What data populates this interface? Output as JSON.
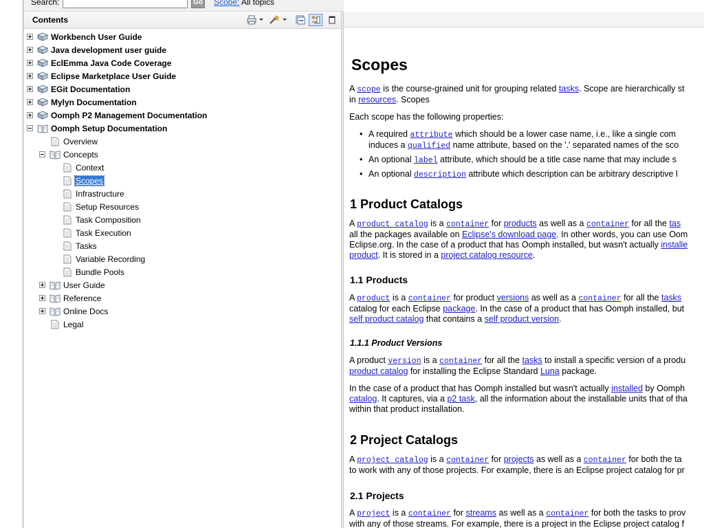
{
  "search": {
    "label": "Search:",
    "go_label": "Go",
    "scope_link": "Scope:",
    "scope_value": "All topics"
  },
  "contents": {
    "title": "Contents"
  },
  "tree": [
    {
      "label": "Workbench User Guide",
      "bold": true,
      "level": 0,
      "expander": "plus",
      "icon": "book-icon"
    },
    {
      "label": "Java development user guide",
      "bold": true,
      "level": 0,
      "expander": "plus",
      "icon": "book-icon"
    },
    {
      "label": "EclEmma Java Code Coverage",
      "bold": true,
      "level": 0,
      "expander": "plus",
      "icon": "book-icon"
    },
    {
      "label": "Eclipse Marketplace User Guide",
      "bold": true,
      "level": 0,
      "expander": "plus",
      "icon": "book-icon"
    },
    {
      "label": "EGit Documentation",
      "bold": true,
      "level": 0,
      "expander": "plus",
      "icon": "book-icon"
    },
    {
      "label": "Mylyn Documentation",
      "bold": true,
      "level": 0,
      "expander": "plus",
      "icon": "book-icon"
    },
    {
      "label": "Oomph P2 Management Documentation",
      "bold": true,
      "level": 0,
      "expander": "plus",
      "icon": "book-icon"
    },
    {
      "label": "Oomph Setup Documentation",
      "bold": true,
      "level": 0,
      "expander": "minus",
      "icon": "open-book-icon"
    },
    {
      "label": "Overview",
      "level": 1,
      "expander": "none",
      "icon": "page-icon"
    },
    {
      "label": "Concepts",
      "level": 1,
      "expander": "minus",
      "icon": "open-book-icon"
    },
    {
      "label": "Context",
      "level": 2,
      "expander": "none",
      "icon": "page-icon"
    },
    {
      "label": "Scopes",
      "level": 2,
      "expander": "none",
      "icon": "page-icon",
      "selected": true
    },
    {
      "label": "Infrastructure",
      "level": 2,
      "expander": "none",
      "icon": "page-icon"
    },
    {
      "label": "Setup Resources",
      "level": 2,
      "expander": "none",
      "icon": "page-icon"
    },
    {
      "label": "Task Composition",
      "level": 2,
      "expander": "none",
      "icon": "page-icon"
    },
    {
      "label": "Task Execution",
      "level": 2,
      "expander": "none",
      "icon": "page-icon"
    },
    {
      "label": "Tasks",
      "level": 2,
      "expander": "none",
      "icon": "page-icon"
    },
    {
      "label": "Variable Recording",
      "level": 2,
      "expander": "none",
      "icon": "page-icon"
    },
    {
      "label": "Bundle Pools",
      "level": 2,
      "expander": "none",
      "icon": "page-icon"
    },
    {
      "label": "User Guide",
      "level": 1,
      "expander": "plus",
      "icon": "open-book-icon"
    },
    {
      "label": "Reference",
      "level": 1,
      "expander": "plus",
      "icon": "open-book-icon"
    },
    {
      "label": "Online Docs",
      "level": 1,
      "expander": "plus",
      "icon": "open-book-icon"
    },
    {
      "label": "Legal",
      "level": 1,
      "expander": "none",
      "icon": "page-icon"
    }
  ],
  "doc": {
    "title": "Scopes",
    "intro": {
      "t1": "A ",
      "c1": "scope",
      "t2": " is the course-grained unit for grouping related ",
      "a1": "tasks",
      "t3": ". Scope are hierarchically st",
      "t4": "in ",
      "a2": "resources",
      "t5": ". Scopes"
    },
    "props_intro": "Each scope has the following properties:",
    "bullets": {
      "b1": {
        "t1": "A required ",
        "c1": "attribute",
        "t2": " which should be a lower case name, i.e., like a single com",
        "t3": "induces a ",
        "c2": "qualified",
        "t4": " name attribute, based on the '.' separated names of the sco"
      },
      "b2": {
        "t1": "An optional ",
        "c1": "label",
        "t2": " attribute, which should be a title case name that may include s"
      },
      "b3": {
        "t1": "An optional ",
        "c1": "description",
        "t2": " attribute which description can be arbitrary descriptive l"
      }
    },
    "s1": {
      "heading": "1  Product Catalogs",
      "t1": "A ",
      "c1": "product catalog",
      "t2": " is a ",
      "c2": "container",
      "t3": " for ",
      "a1": "products",
      "t4": " as well as a ",
      "c3": "container",
      "t5": " for all the ",
      "a2": "tas",
      "t6": "all the packages available on ",
      "a3": "Eclipse's download page",
      "t7": ". In other words, you can use Oom",
      "t8": "Eclipse.org. In the case of a product that has Oomph installed, but wasn't actually ",
      "a4": "installe",
      "a5": "product",
      "t9": ". It is stored in a ",
      "a6": "project catalog resource",
      "t10": "."
    },
    "s11": {
      "heading": "1.1  Products",
      "t1": "A ",
      "c1": "product",
      "t2": " is a ",
      "c2": "container",
      "t3": " for product ",
      "a1": "versions",
      "t4": " as well as a ",
      "c3": "container",
      "t5": " for all the ",
      "a2": "tasks",
      "t6": "catalog for each Eclipse ",
      "a3": "package",
      "t7": ". In the case of a product that has Oomph installed, but",
      "a4": "self product catalog",
      "t8": " that contains a ",
      "a5": "self product version",
      "t9": "."
    },
    "s111": {
      "heading": "1.1.1  Product Versions",
      "t1": "A product ",
      "c1": "version",
      "t2": " is a ",
      "c2": "container",
      "t3": " for all the ",
      "a1": "tasks",
      "t4": " to install a specific version of a produ",
      "a2": "product catalog",
      "t5": " for installing the Eclipse Standard ",
      "a3": "Luna",
      "t6": " package.",
      "p2_t1": "In the case of a product that has Oomph installed but wasn't actually ",
      "p2_a1": "installed",
      "p2_t2": " by Oomph",
      "p2_a2": "catalog",
      "p2_t3": ". It captures, via a ",
      "p2_a3": "p2 task",
      "p2_t4": ", all the information about the installable units that of tha",
      "p2_t5": "within that product installation."
    },
    "s2": {
      "heading": "2  Project Catalogs",
      "t1": "A ",
      "c1": "project catalog",
      "t2": " is a ",
      "c2": "container",
      "t3": " for ",
      "a1": "projects",
      "t4": " as well as a ",
      "c3": "container",
      "t5": " for both the ta",
      "t6": "to work with any of those projects. For example, there is an Eclipse project catalog for pr"
    },
    "s21": {
      "heading": "2.1  Projects",
      "t1": "A ",
      "c1": "project",
      "t2": " is a ",
      "c2": "container",
      "t3": " for ",
      "a1": "streams",
      "t4": " as well as a ",
      "c3": "container",
      "t5": " for both the tasks to prov",
      "t6": "with any of those streams. For example, there is a project in the Eclipse project catalog f"
    }
  }
}
